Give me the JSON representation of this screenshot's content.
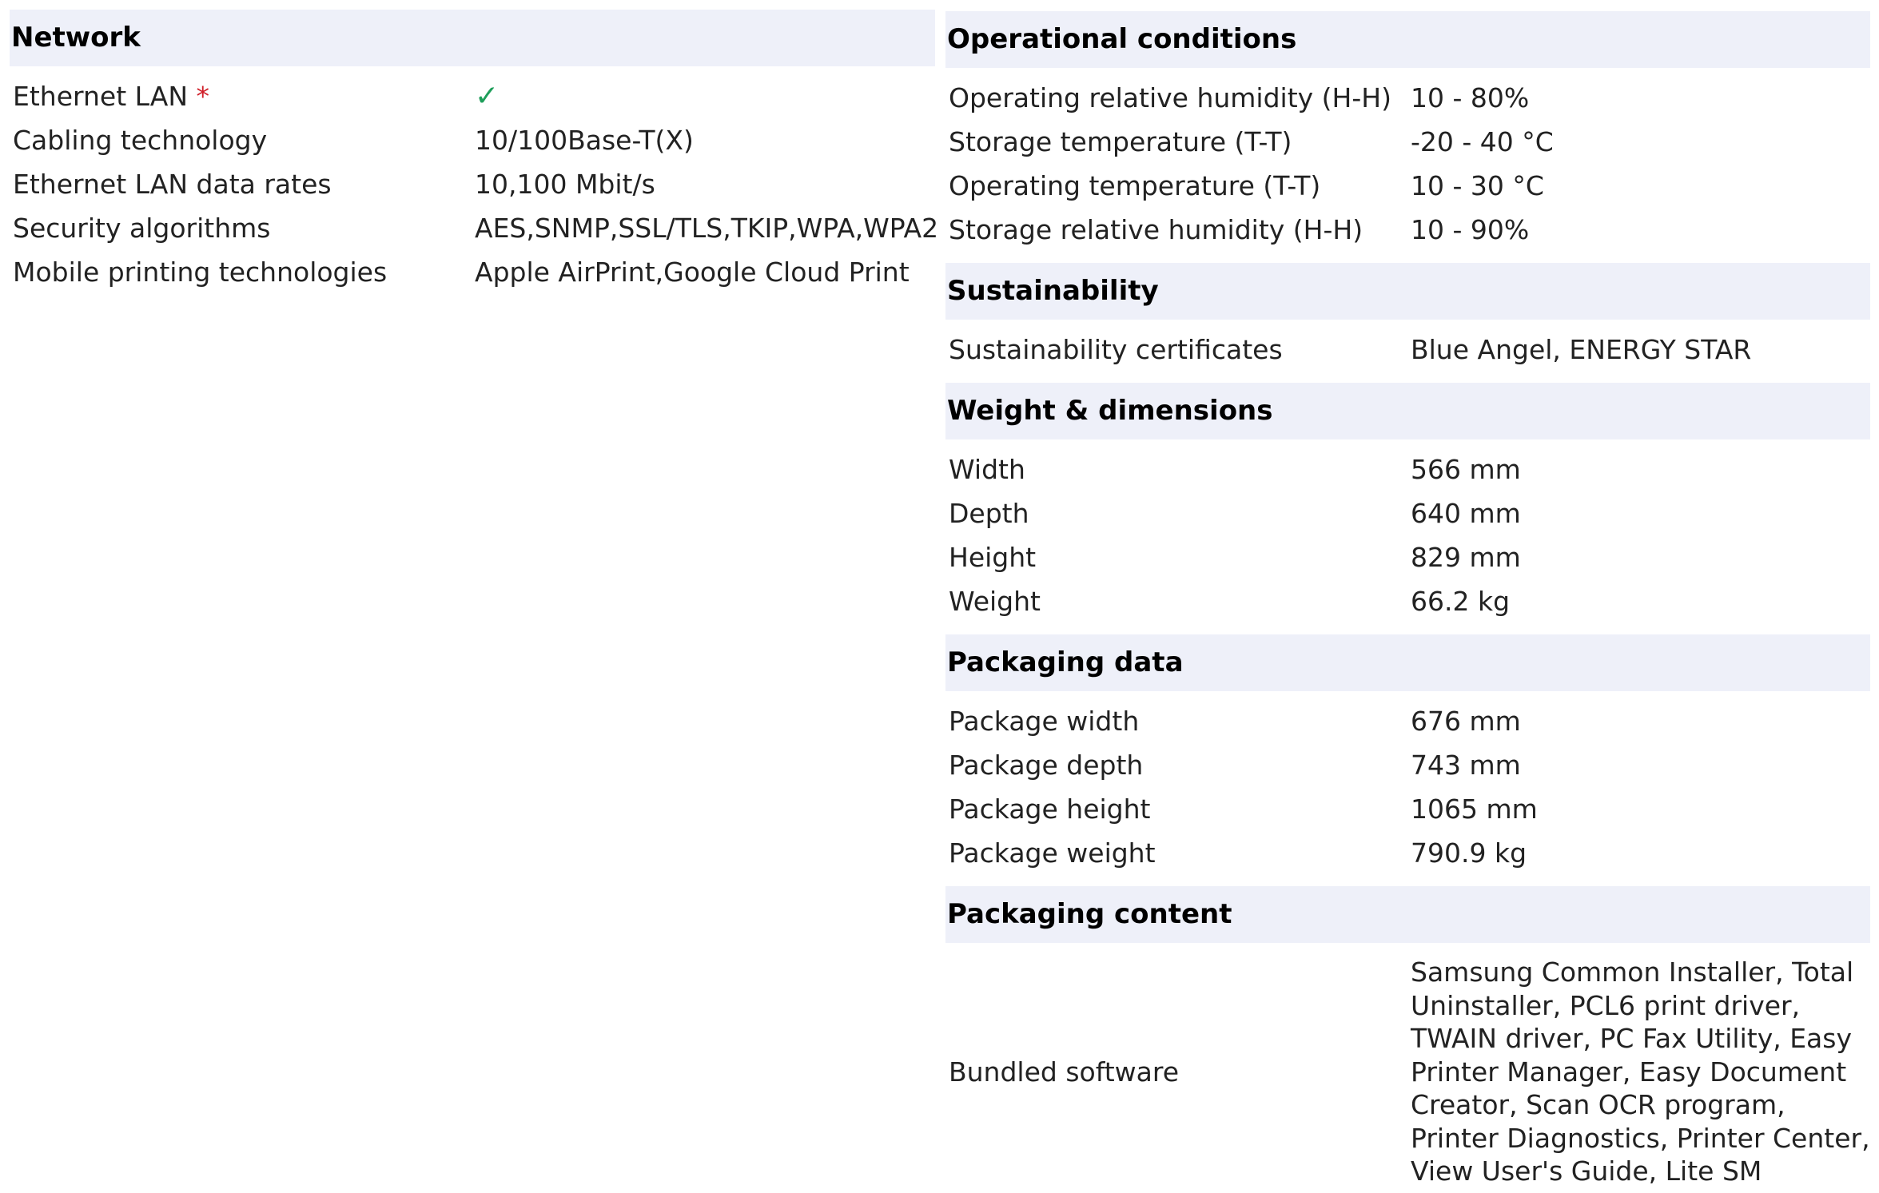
{
  "network": {
    "title": "Network",
    "rows": [
      {
        "label": "Ethernet LAN",
        "required_mark": "*",
        "value_icon": "checkmark-icon"
      },
      {
        "label": "Cabling technology",
        "value": "10/100Base-T(X)"
      },
      {
        "label": "Ethernet LAN data rates",
        "value": "10,100 Mbit/s"
      },
      {
        "label": "Security algorithms",
        "value": "AES,SNMP,SSL/TLS,TKIP,WPA,WPA2"
      },
      {
        "label": "Mobile printing technologies",
        "value": "Apple AirPrint,Google Cloud Print"
      }
    ]
  },
  "operational": {
    "title": "Operational conditions",
    "rows": [
      {
        "label": "Operating relative humidity (H-H)",
        "value": "10 - 80%"
      },
      {
        "label": "Storage temperature (T-T)",
        "value": "-20 - 40 °C"
      },
      {
        "label": "Operating temperature (T-T)",
        "value": "10 - 30 °C"
      },
      {
        "label": "Storage relative humidity (H-H)",
        "value": "10 - 90%"
      }
    ]
  },
  "sustainability": {
    "title": "Sustainability",
    "rows": [
      {
        "label": "Sustainability certificates",
        "value": "Blue Angel, ENERGY STAR"
      }
    ]
  },
  "weight_dimensions": {
    "title": "Weight & dimensions",
    "rows": [
      {
        "label": "Width",
        "value": "566 mm"
      },
      {
        "label": "Depth",
        "value": "640 mm"
      },
      {
        "label": "Height",
        "value": "829 mm"
      },
      {
        "label": "Weight",
        "value": "66.2 kg"
      }
    ]
  },
  "packaging_data": {
    "title": "Packaging data",
    "rows": [
      {
        "label": "Package width",
        "value": "676 mm"
      },
      {
        "label": "Package depth",
        "value": "743 mm"
      },
      {
        "label": "Package height",
        "value": "1065 mm"
      },
      {
        "label": "Package weight",
        "value": "790.9 kg"
      }
    ]
  },
  "packaging_content": {
    "title": "Packaging content",
    "rows": [
      {
        "label": "Bundled software",
        "value": "Samsung Common Installer, Total Uninstaller, PCL6 print driver, TWAIN driver, PC Fax Utility, Easy Printer Manager, Easy Document Creator, Scan OCR program, Printer Diagnostics, Printer Center, View User's Guide, Lite SM"
      }
    ]
  },
  "colors": {
    "header_bg": "#eef0f9",
    "check": "#1e9e5a",
    "required": "#d0202a"
  }
}
